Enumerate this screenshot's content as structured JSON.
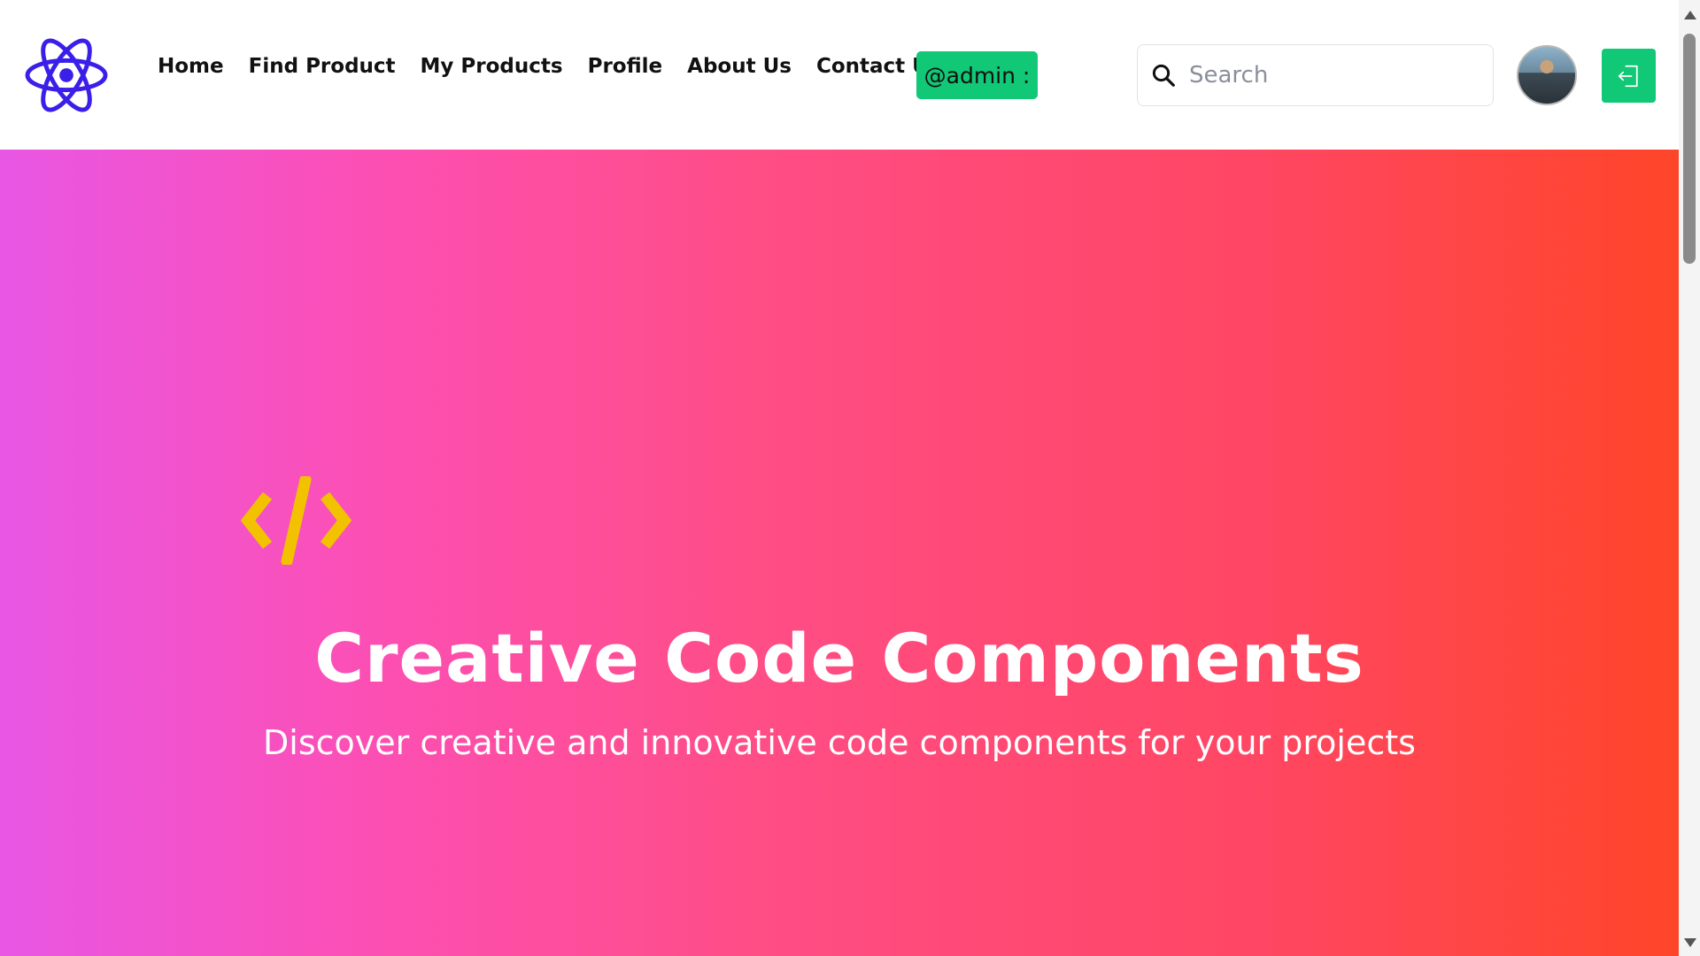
{
  "navbar": {
    "links": [
      {
        "label": "Home"
      },
      {
        "label": "Find Product"
      },
      {
        "label": "My Products"
      },
      {
        "label": "Profile"
      },
      {
        "label": "About Us"
      },
      {
        "label": "Contact Us"
      }
    ],
    "admin_badge": "@admin :",
    "search": {
      "placeholder": "Search",
      "value": ""
    },
    "logo_icon": "react-atom-icon",
    "logout_icon": "logout-icon",
    "colors": {
      "accent": "#10c876",
      "logo": "#3a1fe8"
    }
  },
  "hero": {
    "icon": "code-icon",
    "title": "Creative Code Components",
    "subtitle": "Discover creative and innovative code components for your projects",
    "colors": {
      "gradient_start": "#e857e4",
      "gradient_end": "#ff4528",
      "icon": "#f2c200"
    }
  }
}
